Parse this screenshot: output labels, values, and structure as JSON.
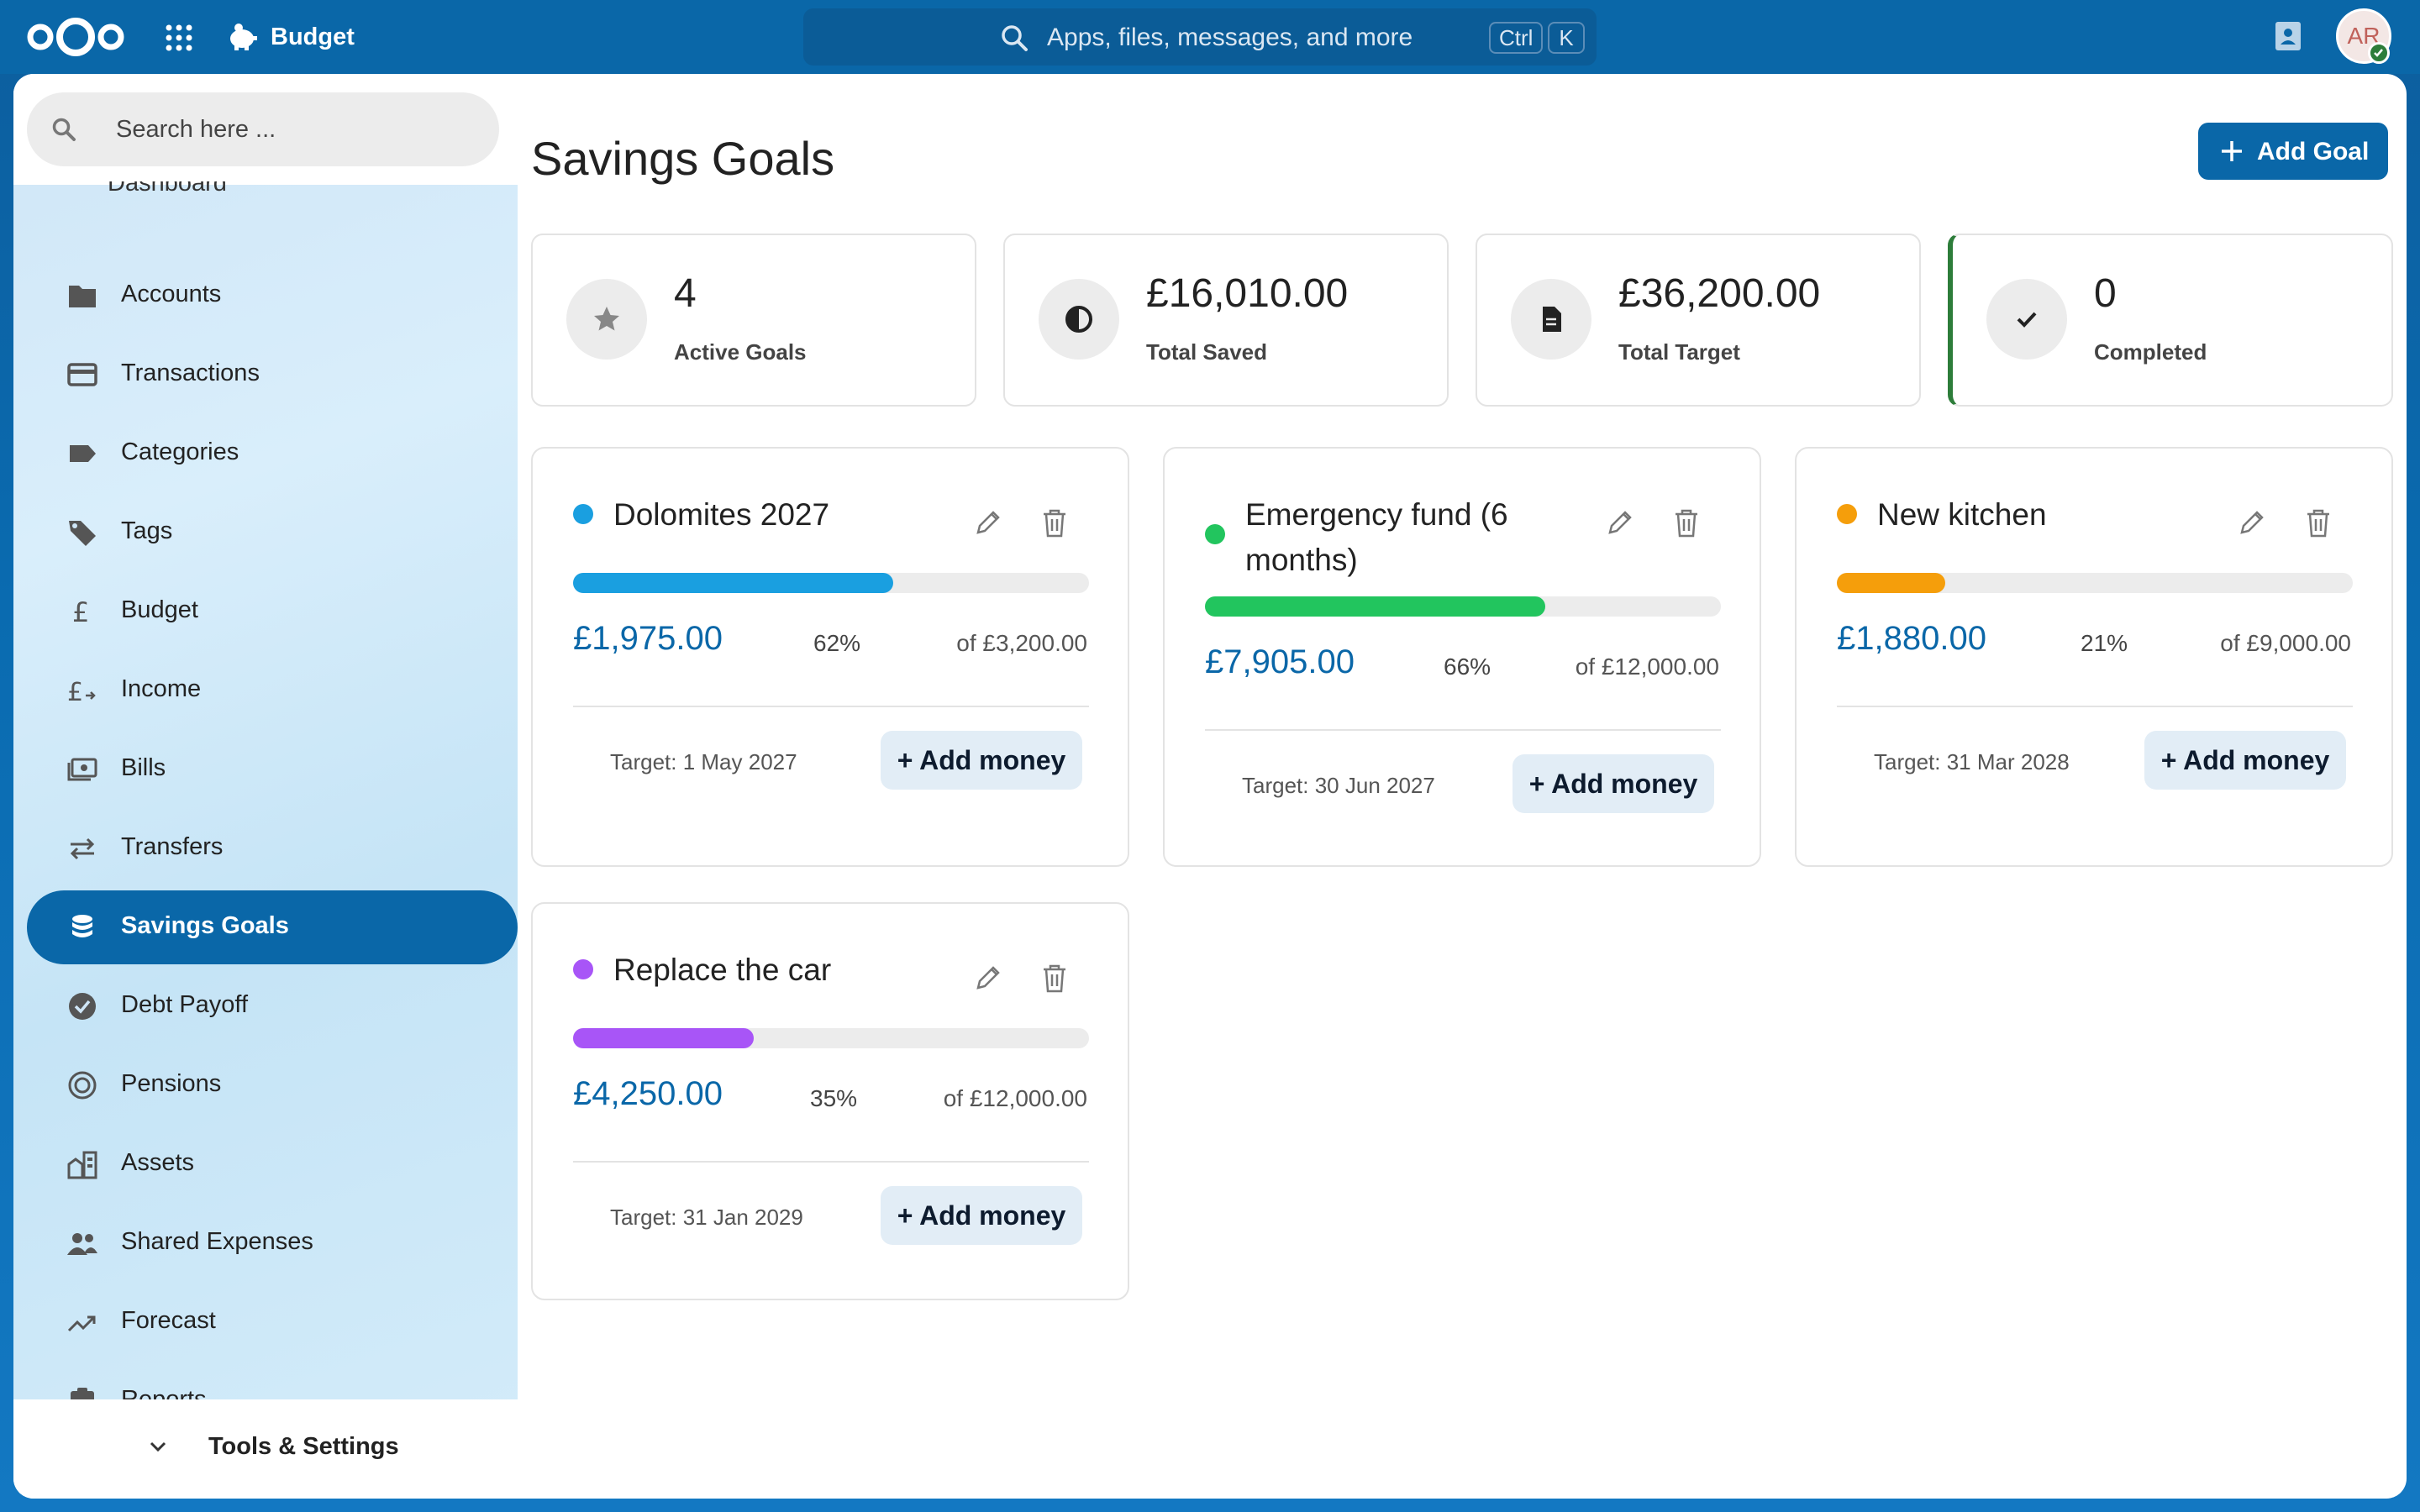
{
  "header": {
    "app_name": "Budget",
    "search_placeholder": "Apps, files, messages, and more",
    "shortcut_keys": [
      "Ctrl",
      "K"
    ],
    "avatar_initials": "AR"
  },
  "sidebar": {
    "search_placeholder": "Search here ...",
    "cut_item_label": "Dashboard",
    "items": [
      {
        "label": "Accounts",
        "icon": "folder-icon"
      },
      {
        "label": "Transactions",
        "icon": "credit-card-icon"
      },
      {
        "label": "Categories",
        "icon": "label-icon"
      },
      {
        "label": "Tags",
        "icon": "tag-icon"
      },
      {
        "label": "Budget",
        "icon": "pound-icon"
      },
      {
        "label": "Income",
        "icon": "pound-arrow-icon"
      },
      {
        "label": "Bills",
        "icon": "bill-icon"
      },
      {
        "label": "Transfers",
        "icon": "swap-icon"
      },
      {
        "label": "Savings Goals",
        "icon": "coin-stack-icon",
        "active": true
      },
      {
        "label": "Debt Payoff",
        "icon": "check-circle-icon"
      },
      {
        "label": "Pensions",
        "icon": "ring-icon"
      },
      {
        "label": "Assets",
        "icon": "buildings-icon"
      },
      {
        "label": "Shared Expenses",
        "icon": "people-icon"
      },
      {
        "label": "Forecast",
        "icon": "trending-up-icon"
      },
      {
        "label": "Reports",
        "icon": "clipboard-icon"
      }
    ],
    "footer_label": "Tools & Settings"
  },
  "main": {
    "title": "Savings Goals",
    "add_goal_label": "Add Goal",
    "stats": [
      {
        "value": "4",
        "label": "Active Goals",
        "icon": "star-icon"
      },
      {
        "value": "£16,010.00",
        "label": "Total Saved",
        "icon": "half-circle-icon"
      },
      {
        "value": "£36,200.00",
        "label": "Total Target",
        "icon": "document-icon"
      },
      {
        "value": "0",
        "label": "Completed",
        "icon": "check-icon"
      }
    ],
    "goals": [
      {
        "name": "Dolomites 2027",
        "color": "#1a9fe0",
        "saved": "£1,975.00",
        "percent": "62%",
        "progress": 0.62,
        "target_amount": "of £3,200.00",
        "target_date": "Target: 1 May 2027",
        "add_label": "+ Add money"
      },
      {
        "name": "Emergency fund (6 months)",
        "color": "#22c55e",
        "saved": "£7,905.00",
        "percent": "66%",
        "progress": 0.66,
        "target_amount": "of £12,000.00",
        "target_date": "Target: 30 Jun 2027",
        "add_label": "+ Add money"
      },
      {
        "name": "New kitchen",
        "color": "#f59e0b",
        "saved": "£1,880.00",
        "percent": "21%",
        "progress": 0.21,
        "target_amount": "of £9,000.00",
        "target_date": "Target: 31 Mar 2028",
        "add_label": "+ Add money"
      },
      {
        "name": "Replace the car",
        "color": "#a855f7",
        "saved": "£4,250.00",
        "percent": "35%",
        "progress": 0.35,
        "target_amount": "of £12,000.00",
        "target_date": "Target: 31 Jan 2029",
        "add_label": "+ Add money"
      }
    ]
  },
  "colors": {
    "accent": "#0a67a8",
    "completed_accent": "#2d7d3a"
  }
}
